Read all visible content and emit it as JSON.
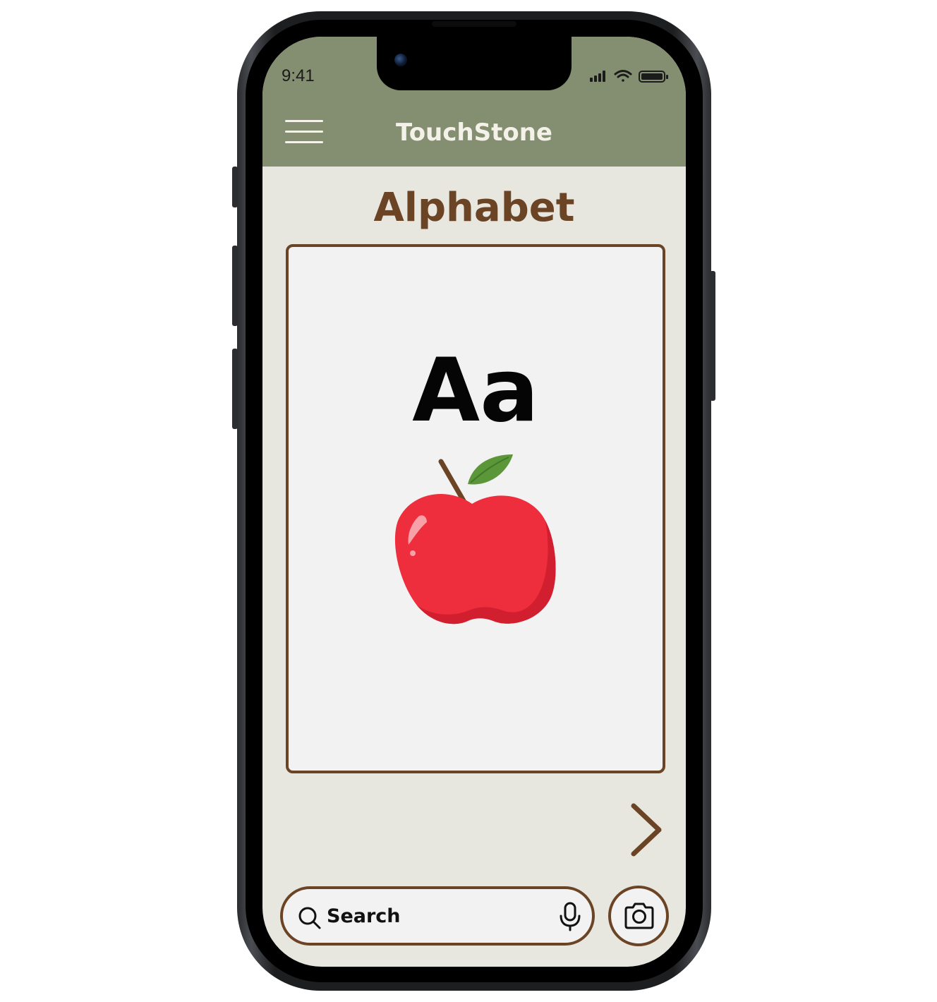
{
  "status_bar": {
    "time": "9:41"
  },
  "header": {
    "app_title": "TouchStone",
    "menu_icon": "hamburger-menu-icon"
  },
  "page": {
    "title": "Alphabet"
  },
  "flashcard": {
    "letter": "Aa",
    "image": "apple-illustration"
  },
  "navigation": {
    "next_icon": "chevron-right-icon"
  },
  "search": {
    "placeholder": "Search",
    "search_icon": "magnifier-icon",
    "mic_icon": "microphone-icon"
  },
  "camera": {
    "icon": "camera-icon"
  },
  "colors": {
    "header_bg": "#848e70",
    "screen_bg": "#e8e7df",
    "accent_brown": "#6b4426",
    "card_bg": "#f3f2f2",
    "apple_red": "#ee2e3c",
    "leaf_green": "#5b9638"
  }
}
